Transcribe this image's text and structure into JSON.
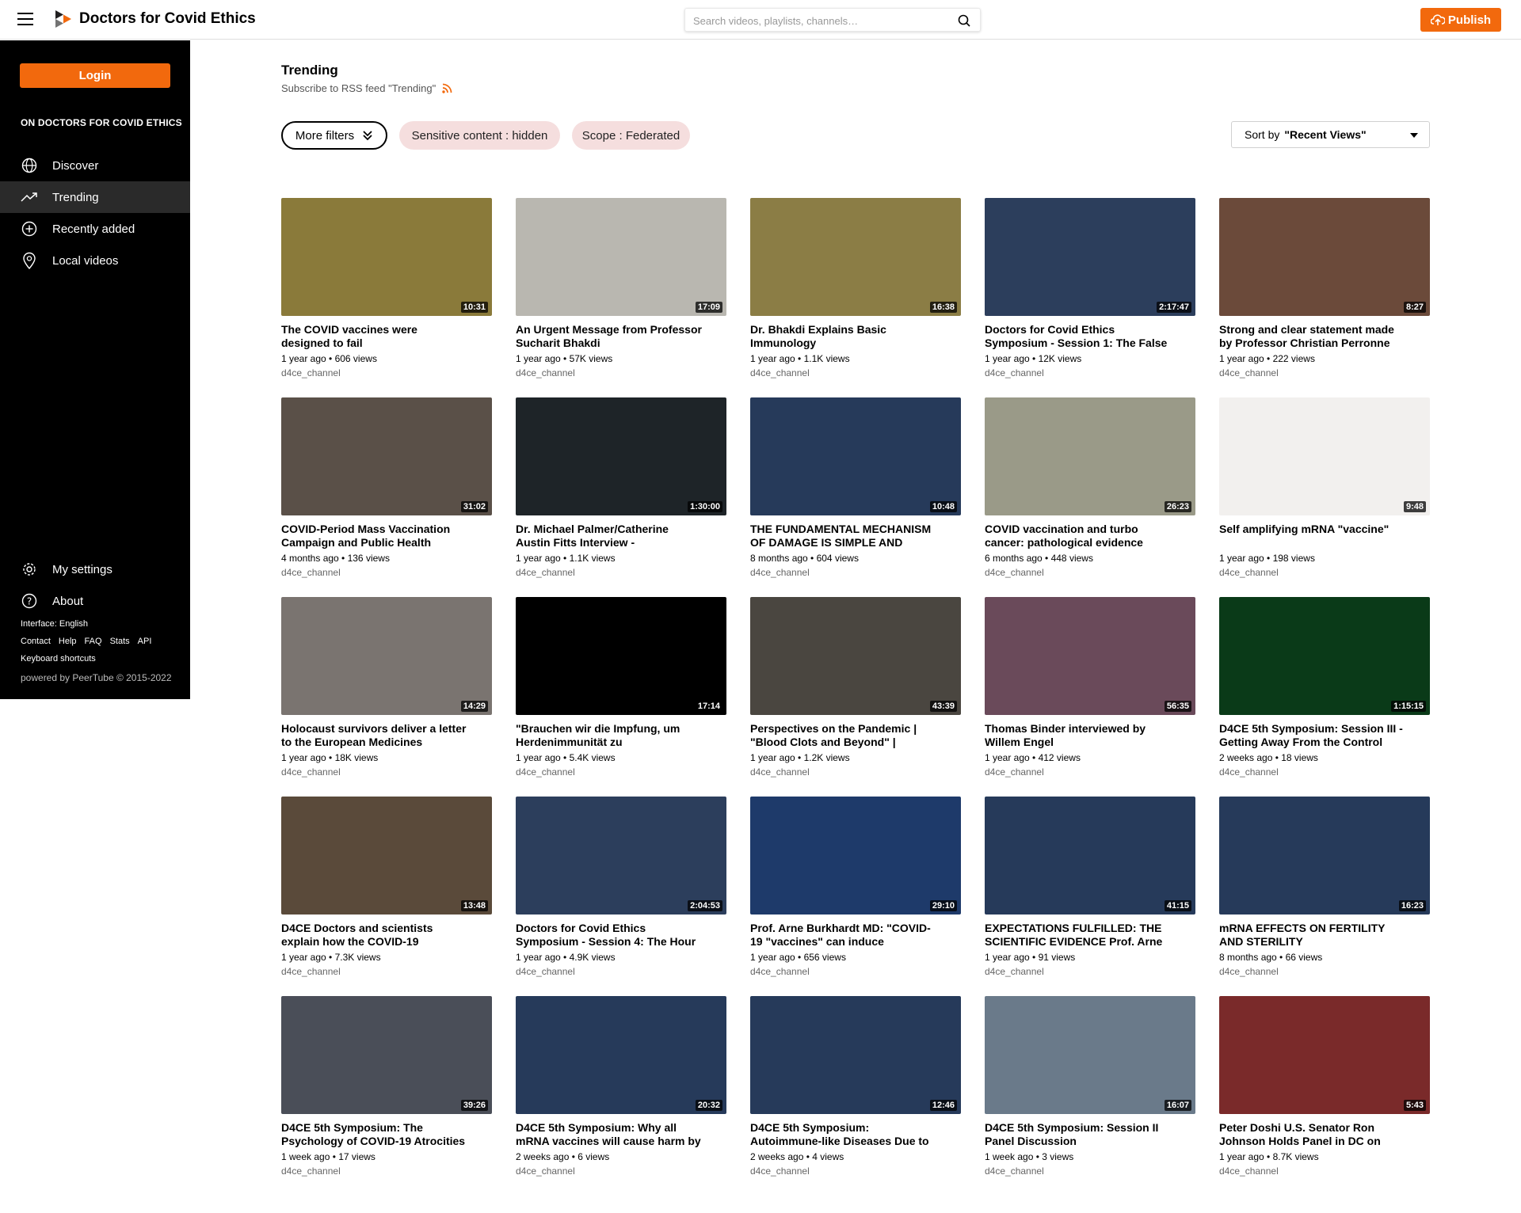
{
  "header": {
    "brand": "Doctors for Covid Ethics",
    "search_placeholder": "Search videos, playlists, channels…",
    "publish_label": "Publish",
    "accent": "#f2690d"
  },
  "sidebar": {
    "login_label": "Login",
    "heading": "ON DOCTORS FOR COVID ETHICS",
    "nav": [
      {
        "label": "Discover",
        "icon": "globe-icon"
      },
      {
        "label": "Trending",
        "icon": "trending-icon"
      },
      {
        "label": "Recently added",
        "icon": "plus-circle-icon"
      },
      {
        "label": "Local videos",
        "icon": "location-icon"
      }
    ],
    "settings_label": "My settings",
    "about_label": "About",
    "interface_label": "Interface: English",
    "footer_links": [
      "Contact",
      "Help",
      "FAQ",
      "Stats",
      "API"
    ],
    "shortcuts_label": "Keyboard shortcuts",
    "powered_by": "powered by PeerTube © 2015-2022"
  },
  "main": {
    "title": "Trending",
    "rss_text": "Subscribe to RSS feed \"Trending\"",
    "more_filters": "More filters",
    "filter_pills": [
      "Sensitive content : hidden",
      "Scope : Federated"
    ],
    "sort_prefix": "Sort by",
    "sort_value": "\"Recent Views\""
  },
  "videos": [
    {
      "title": "The COVID vaccines were designed to fail",
      "meta": "1 year ago • 606 views",
      "channel": "d4ce_channel",
      "duration": "10:31",
      "bg": "#8a7a3a"
    },
    {
      "title": "An Urgent Message from Professor Sucharit Bhakdi",
      "meta": "1 year ago • 57K views",
      "channel": "d4ce_channel",
      "duration": "17:09",
      "bg": "#b9b7b0"
    },
    {
      "title": "Dr. Bhakdi Explains Basic Immunology",
      "meta": "1 year ago • 1.1K views",
      "channel": "d4ce_channel",
      "duration": "16:38",
      "bg": "#8b7d45"
    },
    {
      "title": "Doctors for Covid Ethics Symposium - Session 1: The False",
      "meta": "1 year ago • 12K views",
      "channel": "d4ce_channel",
      "duration": "2:17:47",
      "bg": "#2c3e5c"
    },
    {
      "title": "Strong and clear statement made by Professor Christian Perronne",
      "meta": "1 year ago • 222 views",
      "channel": "d4ce_channel",
      "duration": "8:27",
      "bg": "#6b4a3a"
    },
    {
      "title": "COVID-Period Mass Vaccination Campaign and Public Health",
      "meta": "4 months ago • 136 views",
      "channel": "d4ce_channel",
      "duration": "31:02",
      "bg": "#5a5048"
    },
    {
      "title": "Dr. Michael Palmer/Catherine Austin Fitts Interview -",
      "meta": "1 year ago • 1.1K views",
      "channel": "d4ce_channel",
      "duration": "1:30:00",
      "bg": "#1e2428"
    },
    {
      "title": "THE FUNDAMENTAL MECHANISM OF DAMAGE IS SIMPLE AND",
      "meta": "8 months ago • 604 views",
      "channel": "d4ce_channel",
      "duration": "10:48",
      "bg": "#263a5a"
    },
    {
      "title": "COVID vaccination and turbo cancer: pathological evidence",
      "meta": "6 months ago • 448 views",
      "channel": "d4ce_channel",
      "duration": "26:23",
      "bg": "#9a9a88"
    },
    {
      "title": "Self amplifying mRNA \"vaccine\"",
      "meta": "1 year ago • 198 views",
      "channel": "d4ce_channel",
      "duration": "9:48",
      "bg": "#f2f0ee"
    },
    {
      "title": "Holocaust survivors deliver a letter to the European Medicines",
      "meta": "1 year ago • 18K views",
      "channel": "d4ce_channel",
      "duration": "14:29",
      "bg": "#7a7470"
    },
    {
      "title": "\"Brauchen wir die Impfung, um Herdenimmunität zu",
      "meta": "1 year ago • 5.4K views",
      "channel": "d4ce_channel",
      "duration": "17:14",
      "bg": "#000000"
    },
    {
      "title": "Perspectives on the Pandemic | \"Blood Clots and Beyond\" |",
      "meta": "1 year ago • 1.2K views",
      "channel": "d4ce_channel",
      "duration": "43:39",
      "bg": "#4a4640"
    },
    {
      "title": "Thomas Binder interviewed by Willem Engel",
      "meta": "1 year ago • 412 views",
      "channel": "d4ce_channel",
      "duration": "56:35",
      "bg": "#6a4a5a"
    },
    {
      "title": "D4CE 5th Symposium: Session III - Getting Away From the Control",
      "meta": "2 weeks ago • 18 views",
      "channel": "d4ce_channel",
      "duration": "1:15:15",
      "bg": "#0a3a18"
    },
    {
      "title": "D4CE Doctors and scientists explain how the COVID-19",
      "meta": "1 year ago • 7.3K views",
      "channel": "d4ce_channel",
      "duration": "13:48",
      "bg": "#5a4a3a"
    },
    {
      "title": "Doctors for Covid Ethics Symposium - Session 4: The Hour",
      "meta": "1 year ago • 4.9K views",
      "channel": "d4ce_channel",
      "duration": "2:04:53",
      "bg": "#2c3e5c"
    },
    {
      "title": "Prof. Arne Burkhardt MD: \"COVID-19 \"vaccines\" can induce",
      "meta": "1 year ago • 656 views",
      "channel": "d4ce_channel",
      "duration": "29:10",
      "bg": "#1e3a6a"
    },
    {
      "title": "EXPECTATIONS FULFILLED: THE SCIENTIFIC EVIDENCE Prof. Arne",
      "meta": "1 year ago • 91 views",
      "channel": "d4ce_channel",
      "duration": "41:15",
      "bg": "#263a5a"
    },
    {
      "title": "mRNA EFFECTS ON FERTILITY AND STERILITY",
      "meta": "8 months ago • 66 views",
      "channel": "d4ce_channel",
      "duration": "16:23",
      "bg": "#263a5a"
    },
    {
      "title": "D4CE 5th Symposium: The Psychology of COVID-19 Atrocities",
      "meta": "1 week ago • 17 views",
      "channel": "d4ce_channel",
      "duration": "39:26",
      "bg": "#4a4e58"
    },
    {
      "title": "D4CE 5th Symposium: Why all mRNA vaccines will cause harm by",
      "meta": "2 weeks ago • 6 views",
      "channel": "d4ce_channel",
      "duration": "20:32",
      "bg": "#263a5a"
    },
    {
      "title": "D4CE 5th Symposium: Autoimmune-like Diseases Due to",
      "meta": "2 weeks ago • 4 views",
      "channel": "d4ce_channel",
      "duration": "12:46",
      "bg": "#263a5a"
    },
    {
      "title": "D4CE 5th Symposium: Session II Panel Discussion",
      "meta": "1 week ago • 3 views",
      "channel": "d4ce_channel",
      "duration": "16:07",
      "bg": "#6a7a8a"
    },
    {
      "title": "Peter Doshi U.S. Senator Ron Johnson Holds Panel in DC on",
      "meta": "1 year ago • 8.7K views",
      "channel": "d4ce_channel",
      "duration": "5:43",
      "bg": "#7a2a2a"
    }
  ]
}
